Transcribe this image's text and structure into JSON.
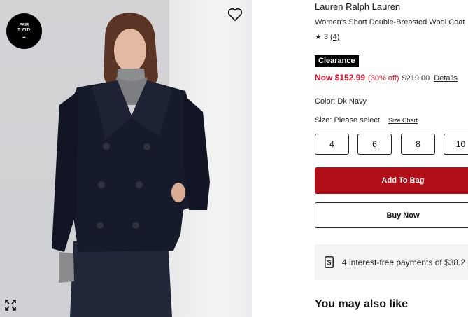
{
  "product_image": {
    "pair_badge": {
      "line1": "PAIR",
      "line2": "IT WITH",
      "chevron": "⌄"
    },
    "heart_icon": "heart-outline-icon",
    "expand_icon": "expand-arrows-icon"
  },
  "product": {
    "brand": "Lauren Ralph Lauren",
    "name": "Women's Short Double-Breasted Wool Coat",
    "rating": {
      "star": "★",
      "value": "3",
      "count": "(4)"
    },
    "badge": "Clearance",
    "price": {
      "now": "Now $152.99",
      "discount": "(30% off)",
      "original": "$219.00",
      "details_link": "Details"
    },
    "color": "Color: Dk Navy",
    "size_label": "Size: Please select",
    "size_chart_link": "Size Chart",
    "sizes": [
      "4",
      "6",
      "8",
      "10"
    ]
  },
  "actions": {
    "add_to_bag": "Add To Bag",
    "buy_now": "Buy Now"
  },
  "installments": {
    "icon": "dollar-sign-icon",
    "text": "4 interest-free payments of $38.2"
  },
  "recommendations": {
    "heading": "You may also like"
  },
  "colors": {
    "sale_red": "#d1122a",
    "add_to_bag_bg": "#b00f19",
    "badge_bg": "#000000",
    "coat_navy": "#161b2c"
  }
}
